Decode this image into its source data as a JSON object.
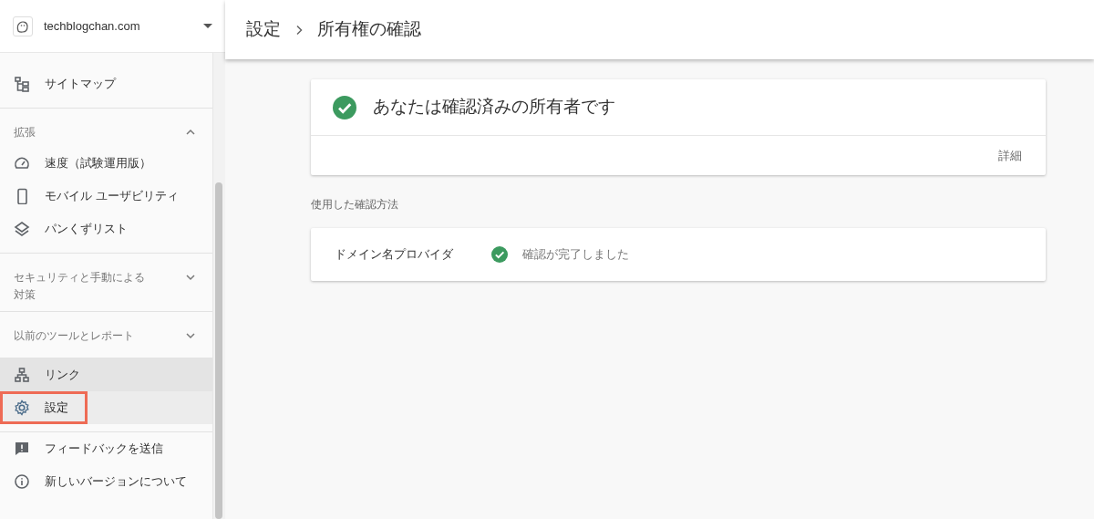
{
  "site": {
    "name": "techblogchan.com"
  },
  "sidebar": {
    "groups": [
      {
        "items": [
          {
            "label": "サイトマップ",
            "selected": false,
            "hover": false,
            "highlight": false
          }
        ]
      },
      {
        "title": "拡張",
        "expanded": true,
        "items": [
          {
            "label": "速度（試験運用版）",
            "selected": false,
            "hover": false,
            "highlight": false
          },
          {
            "label": "モバイル ユーザビリティ",
            "selected": false,
            "hover": false,
            "highlight": false
          },
          {
            "label": "パンくずリスト",
            "selected": false,
            "hover": false,
            "highlight": false
          }
        ]
      },
      {
        "title": "セキュリティと手動による対策",
        "expanded": false
      },
      {
        "title": "以前のツールとレポート",
        "expanded": false
      },
      {
        "items": [
          {
            "label": "リンク",
            "selected": false,
            "hover": true,
            "highlight": false
          },
          {
            "label": "設定",
            "selected": true,
            "hover": false,
            "highlight": true
          }
        ]
      },
      {
        "items": [
          {
            "label": "フィードバックを送信",
            "selected": false,
            "hover": false,
            "highlight": false
          },
          {
            "label": "新しいバージョンについて",
            "selected": false,
            "hover": false,
            "highlight": false
          }
        ]
      }
    ]
  },
  "breadcrumb": [
    "設定",
    "所有権の確認"
  ],
  "status_card": {
    "title": "あなたは確認済みの所有者です",
    "link": "詳細"
  },
  "methods_label": "使用した確認方法",
  "methods": [
    {
      "name": "ドメイン名プロバイダ",
      "status": "確認が完了しました"
    }
  ]
}
